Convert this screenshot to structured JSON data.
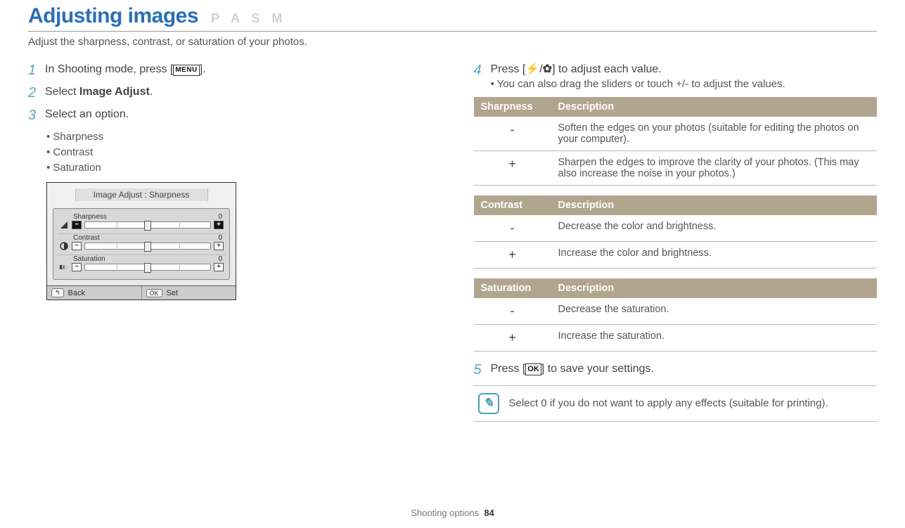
{
  "header": {
    "title": "Adjusting images",
    "modes": "P A S M",
    "subtitle": "Adjust the sharpness, contrast, or saturation of your photos."
  },
  "left": {
    "step1": {
      "num": "1",
      "pre": "In Shooting mode, press [",
      "icon": "MENU",
      "post": "]."
    },
    "step2": {
      "num": "2",
      "pre": "Select ",
      "bold": "Image Adjust",
      "post": "."
    },
    "step3": {
      "num": "3",
      "text": "Select an option."
    },
    "options": [
      "Sharpness",
      "Contrast",
      "Saturation"
    ],
    "panel": {
      "title": "Image Adjust : Sharpness",
      "rows": [
        {
          "label": "Sharpness",
          "value": "0"
        },
        {
          "label": "Contrast",
          "value": "0"
        },
        {
          "label": "Saturation",
          "value": "0"
        }
      ],
      "back": "Back",
      "set": "Set",
      "okKey": "OK"
    }
  },
  "right": {
    "step4": {
      "num": "4",
      "pre": "Press [",
      "mid": "/",
      "post": "] to adjust each value."
    },
    "step4_sub": "You can also drag the sliders or touch +/- to adjust the values.",
    "tables": {
      "sharpness": {
        "h1": "Sharpness",
        "h2": "Description",
        "rows": [
          {
            "sym": "-",
            "desc": "Soften the edges on your photos (suitable for editing the photos on your computer)."
          },
          {
            "sym": "+",
            "desc": "Sharpen the edges to improve the clarity of your photos. (This may also increase the noise in your photos.)"
          }
        ]
      },
      "contrast": {
        "h1": "Contrast",
        "h2": "Description",
        "rows": [
          {
            "sym": "-",
            "desc": "Decrease the color and brightness."
          },
          {
            "sym": "+",
            "desc": "Increase the color and brightness."
          }
        ]
      },
      "saturation": {
        "h1": "Saturation",
        "h2": "Description",
        "rows": [
          {
            "sym": "-",
            "desc": "Decrease the saturation."
          },
          {
            "sym": "+",
            "desc": "Increase the saturation."
          }
        ]
      }
    },
    "step5": {
      "num": "5",
      "pre": "Press [",
      "icon": "OK",
      "post": "] to save your settings."
    },
    "note": "Select 0 if you do not want to apply any effects (suitable for printing)."
  },
  "footer": {
    "section": "Shooting options",
    "page": "84"
  }
}
